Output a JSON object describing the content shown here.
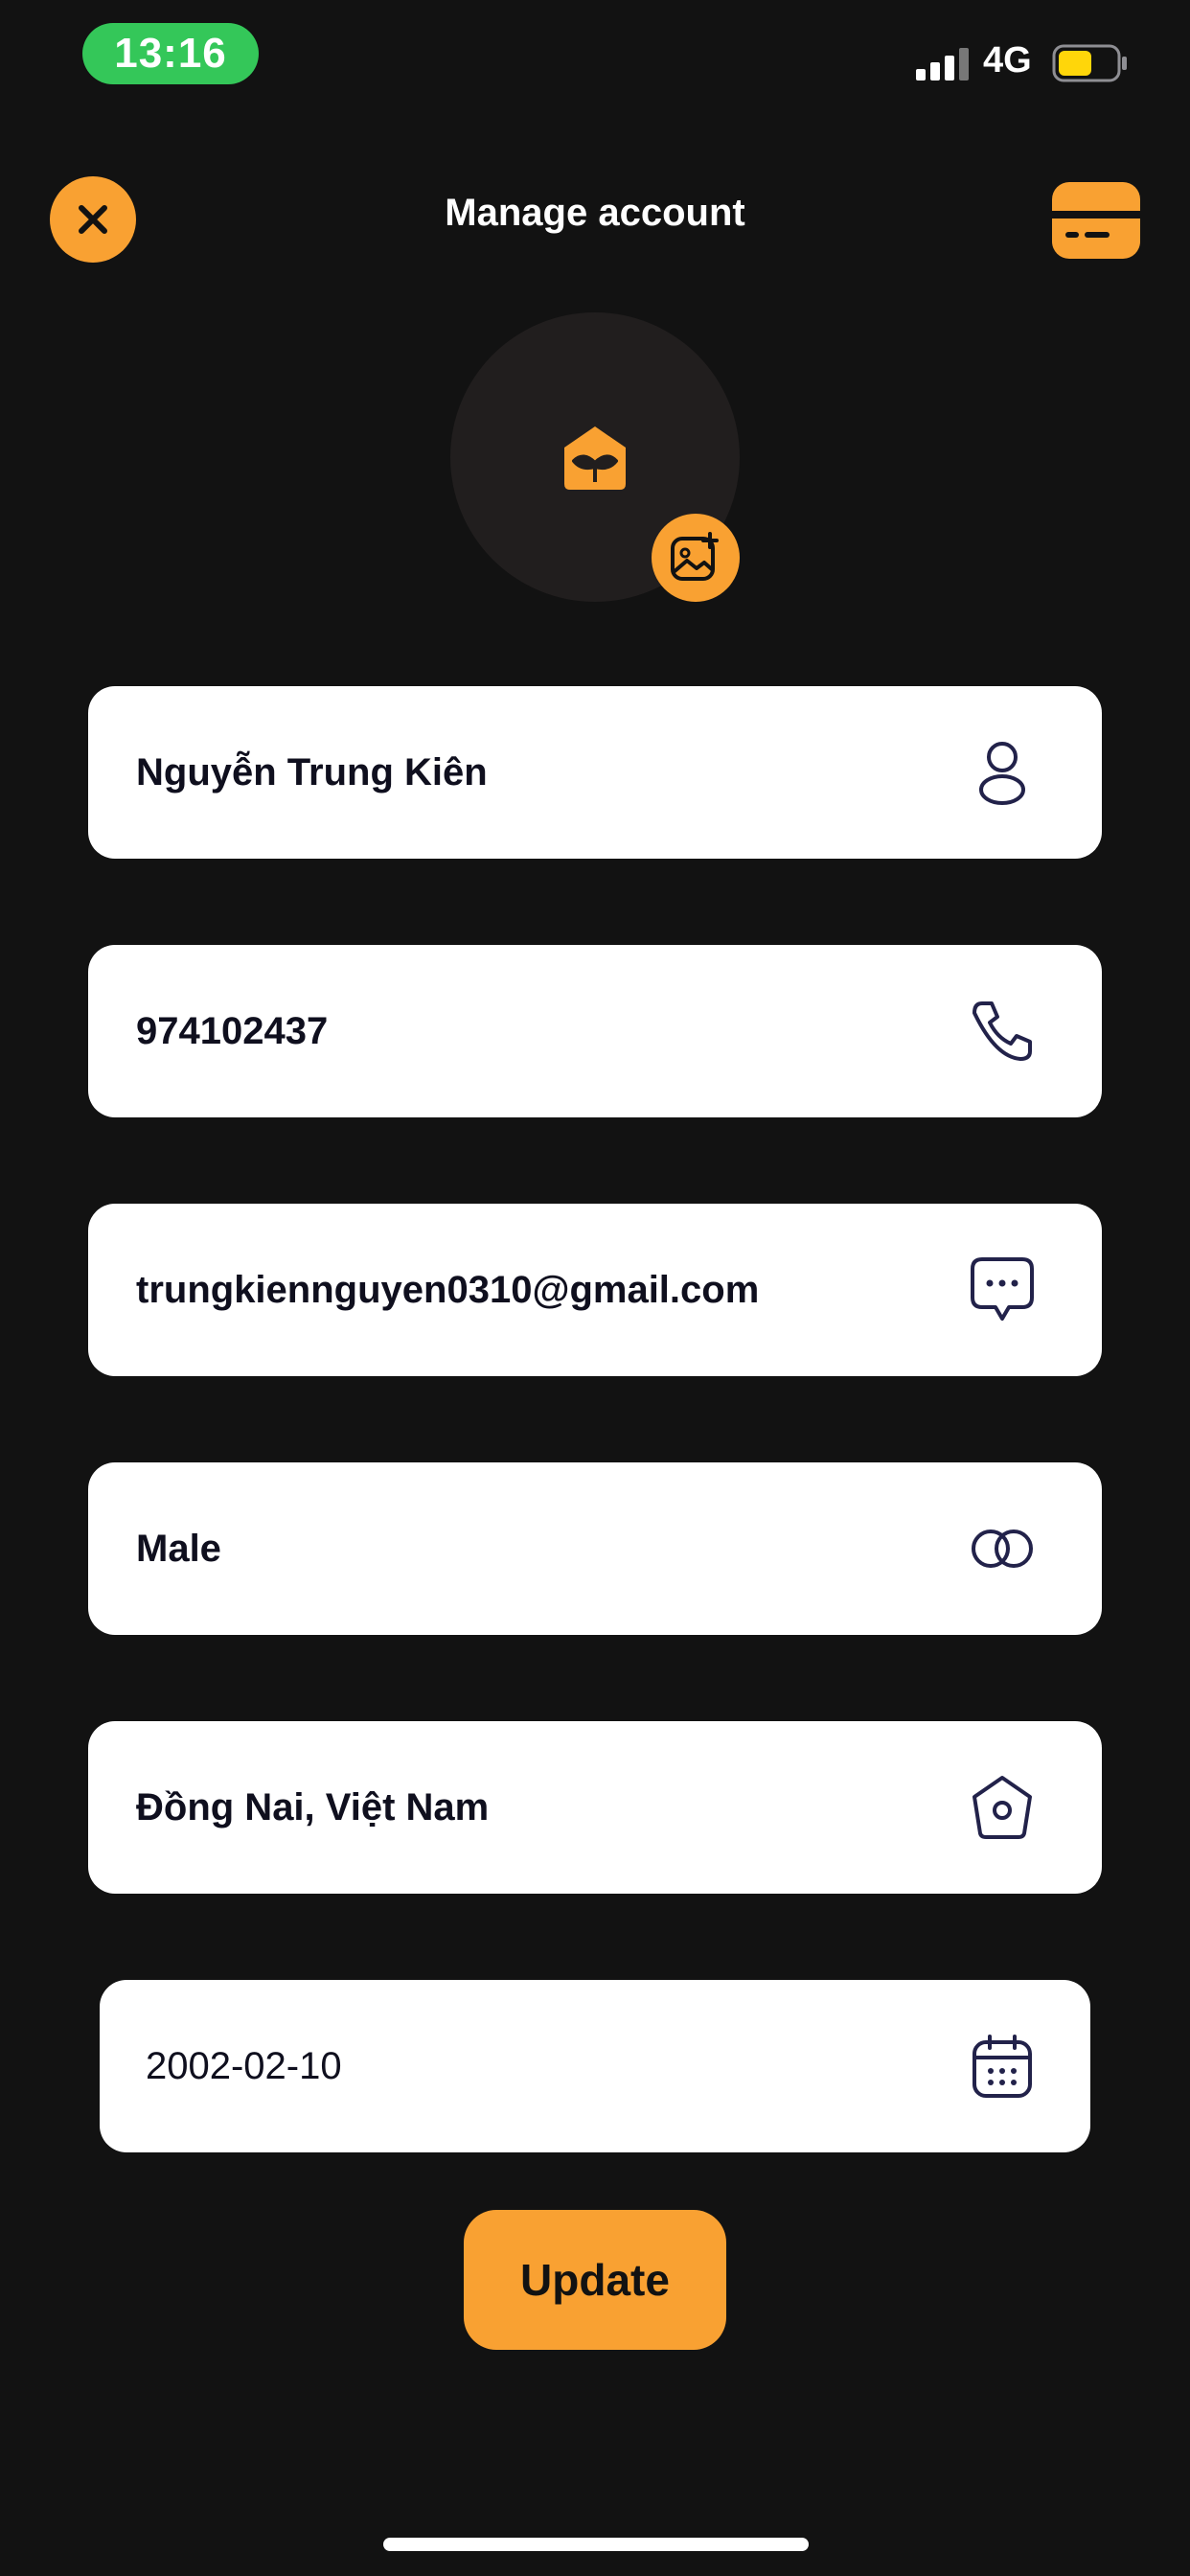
{
  "status_bar": {
    "time": "13:16",
    "network": "4G",
    "battery_color": "#ffd60a"
  },
  "header": {
    "title": "Manage account"
  },
  "colors": {
    "accent": "#f9a132",
    "background": "#121212",
    "field_bg": "#ffffff",
    "icon_stroke": "#22224a"
  },
  "fields": [
    {
      "value": "Nguyễn Trung Kiên",
      "icon": "person-icon"
    },
    {
      "value": "974102437",
      "icon": "phone-icon"
    },
    {
      "value": "trungkiennguyen0310@gmail.com",
      "icon": "message-icon"
    },
    {
      "value": "Male",
      "icon": "gender-icon"
    },
    {
      "value": "Đồng Nai, Việt Nam",
      "icon": "home-icon"
    },
    {
      "value": "2002-02-10",
      "icon": "calendar-icon"
    }
  ],
  "update_label": "Update"
}
